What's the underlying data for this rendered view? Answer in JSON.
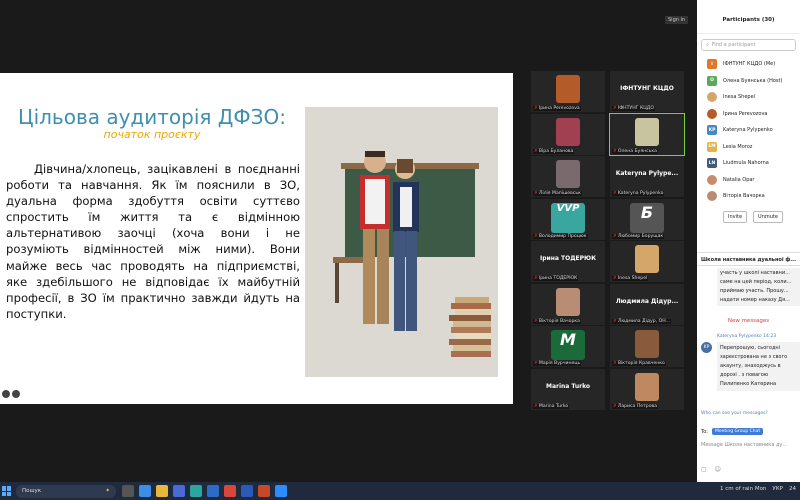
{
  "app": {
    "sign_in_label": "Sign in"
  },
  "slide": {
    "title": "Цільова аудиторія ДФЗО:",
    "subtitle": "початок проєкту",
    "body": "Дівчина/хлопець, зацікавлені в поєднанні роботи та навчання. Як їм пояснили в ЗО, дуальна форма здобуття освіти суттєво спростить їм життя та є відмінною альтернативою заочці (хоча вони і не розуміють відмінностей між ними). Вони майже весь час проводять на підприємстві, яке здебільшого не відповідає їх майбутній професії, в ЗО їм практично завжди йдуть на поступки."
  },
  "video_tiles": [
    {
      "name": "Ірина Perevozova",
      "big": "",
      "face": "#b35c2a"
    },
    {
      "name": "ІФНТУНГ КЦДО",
      "big": "ІФНТУНГ КЦДО",
      "face": ""
    },
    {
      "name": "Віра Буланова",
      "big": "",
      "face": "#a04050"
    },
    {
      "name": "Олена Буянська",
      "big": "",
      "face": "#c9c4a0"
    },
    {
      "name": "Лілія Мапішевськ",
      "big": "",
      "face": "#7a6a6e"
    },
    {
      "name": "Kateryna Pylypenko",
      "big": "Kateryna Pylype...",
      "face": ""
    },
    {
      "name": "Володимир Процюк",
      "big": "VVP",
      "face": "#3aa6a0"
    },
    {
      "name": "Любомир Борущак",
      "big": "Б",
      "face": "#555"
    },
    {
      "name": "Ірина ТОДЕРЮК",
      "big": "Ірина ТОДЕРЮК",
      "face": ""
    },
    {
      "name": "Inesa Shepel",
      "big": "",
      "face": "#d4a66a"
    },
    {
      "name": "Вікторія Вачорка",
      "big": "",
      "face": "#b98c74"
    },
    {
      "name": "Людмила Дідур, ОН...",
      "big": "Людмила Дідур...",
      "face": ""
    },
    {
      "name": "Марія Вурчинець",
      "big": "M",
      "face": "#1b6b3a"
    },
    {
      "name": "Вікторія Кравченко",
      "big": "",
      "face": "#8a5a3c"
    },
    {
      "name": "Marina Turko",
      "big": "Marina Turko",
      "face": ""
    },
    {
      "name": "Лариса Петрова",
      "big": "",
      "face": "#c08860"
    }
  ],
  "panel": {
    "title": "Participants (30)",
    "search_placeholder": "Find a participant",
    "participants": [
      {
        "name": "ІФНТУНГ КЦДО (Me)",
        "initial": "І",
        "color": "#e0772a"
      },
      {
        "name": "Олена Буянська (Host)",
        "initial": "О",
        "color": "#5aa85a"
      },
      {
        "name": "Inesa Shepel",
        "initial": "",
        "color": "#d4a66a"
      },
      {
        "name": "Ірина Perevozova",
        "initial": "",
        "color": "#b35c2a"
      },
      {
        "name": "Kateryna Pylypenko",
        "initial": "KP",
        "color": "#4a87c7"
      },
      {
        "name": "Lesia Moroz",
        "initial": "LM",
        "color": "#e3b34a"
      },
      {
        "name": "Liudmula Nahorna",
        "initial": "LN",
        "color": "#3f5a7a"
      },
      {
        "name": "Natalia Opar",
        "initial": "",
        "color": "#c88c6a"
      },
      {
        "name": "Віторія Вачорка",
        "initial": "",
        "color": "#b98c74"
      }
    ],
    "invite_label": "Invite",
    "mute_label": "Unmute",
    "chat_title": "Школа наставника дуальної ф...",
    "chat_msg1": "участь у школі наставни... саме на цей період, коли... приймаю участь. Прошу... надати номер наказу Дя...",
    "new_messages_label": "New messages",
    "sender": "Kateryna Pylypenko 14:23",
    "sender_initials": "KP",
    "chat_msg2": "Перепрошую, сьогодні зареєстрована не з свого акаунту, знаходжусь в дорозі . з повагою Пилипенко Катерина",
    "who_can_see": "Who can see your messages?",
    "to_label": "To:",
    "to_value": "Meeting Group Chat",
    "message_placeholder": "Message Школа наставника ду..."
  },
  "taskbar": {
    "search_label": "Пошук",
    "weather": "1 cm of rain Mon",
    "lang": "УКР",
    "time": "24"
  }
}
